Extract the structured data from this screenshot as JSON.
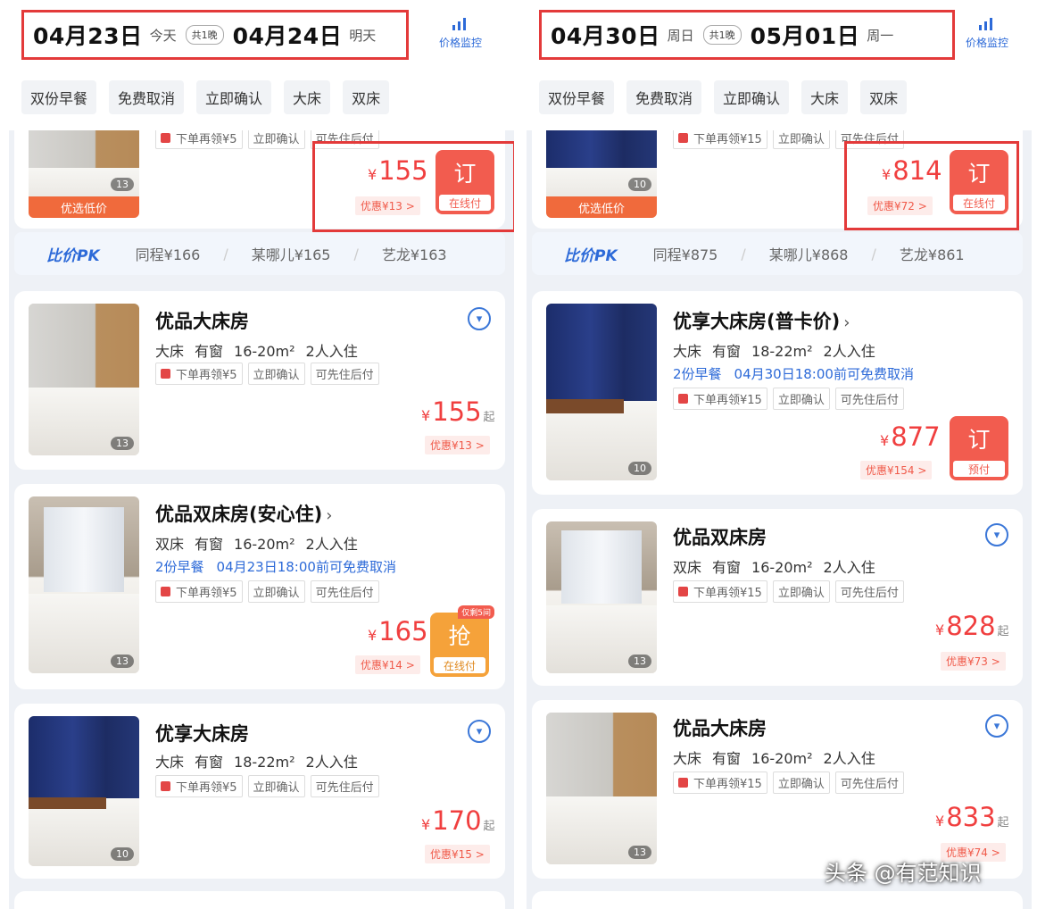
{
  "left": {
    "checkin_date": "04月23日",
    "checkin_label": "今天",
    "nights": "共1晚",
    "checkout_date": "04月24日",
    "checkout_label": "明天",
    "monitor_label": "价格监控",
    "filters": [
      "双份早餐",
      "免费取消",
      "立即确认",
      "大床",
      "双床"
    ],
    "top_card": {
      "image_tag": "优选低价",
      "image_count": "13",
      "badges": [
        "下单再领¥5",
        "立即确认",
        "可先住后付"
      ],
      "currency": "¥",
      "price": "155",
      "discount": "优惠¥13 >",
      "book_label": "订",
      "book_sub": "在线付"
    },
    "pk": {
      "logo": "比价PK",
      "items": [
        "同程¥166",
        "某哪儿¥165",
        "艺龙¥163"
      ]
    },
    "rooms": [
      {
        "name": "优品大床房",
        "info": [
          "大床",
          "有窗",
          "16-20m²",
          "2人入住"
        ],
        "badges": [
          "下单再领¥5",
          "立即确认",
          "可先住后付"
        ],
        "currency": "¥",
        "price": "155",
        "suffix": "起",
        "discount": "优惠¥13 >",
        "image_count": "13"
      },
      {
        "name": "优品双床房(安心住)",
        "arrow": "›",
        "info": [
          "双床",
          "有窗",
          "16-20m²",
          "2人入住"
        ],
        "policy": [
          "2份早餐",
          "04月23日18:00前可免费取消"
        ],
        "badges": [
          "下单再领¥5",
          "立即确认",
          "可先住后付"
        ],
        "currency": "¥",
        "price": "165",
        "discount": "优惠¥14 >",
        "book_label": "抢",
        "book_sub": "在线付",
        "limited": "仅剩5间",
        "image_count": "13"
      },
      {
        "name": "优享大床房",
        "info": [
          "大床",
          "有窗",
          "18-22m²",
          "2人入住"
        ],
        "badges": [
          "下单再领¥5",
          "立即确认",
          "可先住后付"
        ],
        "currency": "¥",
        "price": "170",
        "suffix": "起",
        "discount": "优惠¥15 >",
        "image_count": "10"
      }
    ]
  },
  "right": {
    "checkin_date": "04月30日",
    "checkin_label": "周日",
    "nights": "共1晚",
    "checkout_date": "05月01日",
    "checkout_label": "周一",
    "monitor_label": "价格监控",
    "filters": [
      "双份早餐",
      "免费取消",
      "立即确认",
      "大床",
      "双床"
    ],
    "top_card": {
      "image_tag": "优选低价",
      "image_count": "10",
      "badges": [
        "下单再领¥15",
        "立即确认",
        "可先住后付"
      ],
      "currency": "¥",
      "price": "814",
      "discount": "优惠¥72 >",
      "book_label": "订",
      "book_sub": "在线付"
    },
    "pk": {
      "logo": "比价PK",
      "items": [
        "同程¥875",
        "某哪儿¥868",
        "艺龙¥861"
      ]
    },
    "rooms": [
      {
        "name": "优享大床房(普卡价)",
        "arrow": "›",
        "info": [
          "大床",
          "有窗",
          "18-22m²",
          "2人入住"
        ],
        "policy": [
          "2份早餐",
          "04月30日18:00前可免费取消"
        ],
        "badges": [
          "下单再领¥15",
          "立即确认",
          "可先住后付"
        ],
        "currency": "¥",
        "price": "877",
        "discount": "优惠¥154 >",
        "book_label": "订",
        "book_sub": "预付",
        "image_count": "10"
      },
      {
        "name": "优品双床房",
        "info": [
          "双床",
          "有窗",
          "16-20m²",
          "2人入住"
        ],
        "badges": [
          "下单再领¥15",
          "立即确认",
          "可先住后付"
        ],
        "currency": "¥",
        "price": "828",
        "suffix": "起",
        "discount": "优惠¥73 >",
        "image_count": "13"
      },
      {
        "name": "优品大床房",
        "info": [
          "大床",
          "有窗",
          "16-20m²",
          "2人入住"
        ],
        "badges": [
          "下单再领¥15",
          "立即确认",
          "可先住后付"
        ],
        "currency": "¥",
        "price": "833",
        "suffix": "起",
        "discount": "优惠¥74 >",
        "image_count": "13"
      }
    ]
  },
  "watermark": "头条 @有范知识",
  "colors": {
    "accent_blue": "#2d6ad8",
    "price_red": "#f03f3f",
    "frame_red": "#e33a3a",
    "grab_orange": "#f5a23a"
  }
}
